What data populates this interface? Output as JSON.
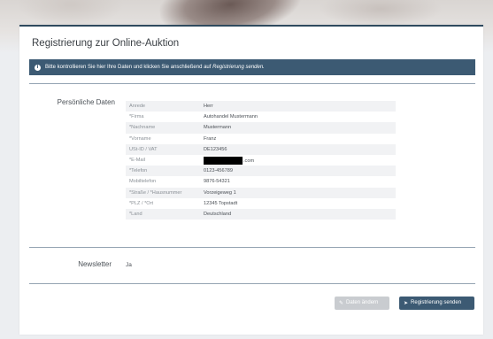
{
  "title": "Registrierung zur Online-Auktion",
  "alert": {
    "text": "Bitte kontrollieren Sie hier Ihre Daten und klicken Sie anschließend auf",
    "emph": "Registrierung senden.",
    "icon": "info-icon"
  },
  "personal": {
    "heading": "Persönliche Daten",
    "rows": [
      {
        "label": "Anrede",
        "value": "Herr"
      },
      {
        "label": "*Firma",
        "value": "Autohandel Mustermann"
      },
      {
        "label": "*Nachname",
        "value": "Mustermann"
      },
      {
        "label": "*Vorname",
        "value": "Franz"
      },
      {
        "label": "USt-ID / VAT",
        "value": "DE123456"
      },
      {
        "label": "*E-Mail",
        "value": ".com"
      },
      {
        "label": "*Telefon",
        "value": "0123-456789"
      },
      {
        "label": "Mobiltelefon",
        "value": "9876-54321"
      },
      {
        "label": "*Straße / *Hausnummer",
        "value": "Vorzeigeweg 1"
      },
      {
        "label": "*PLZ / *Ort",
        "value": "12345 Topstadt"
      },
      {
        "label": "*Land",
        "value": "Deutschland"
      }
    ]
  },
  "newsletter": {
    "heading": "Newsletter",
    "value": "Ja"
  },
  "buttons": {
    "edit": {
      "label": "Daten ändern",
      "icon": "edit-icon"
    },
    "submit": {
      "label": "Registrierung senden",
      "icon": "send-icon"
    }
  },
  "colors": {
    "accent": "#3c5a73",
    "button_secondary": "#c9ccd0"
  }
}
